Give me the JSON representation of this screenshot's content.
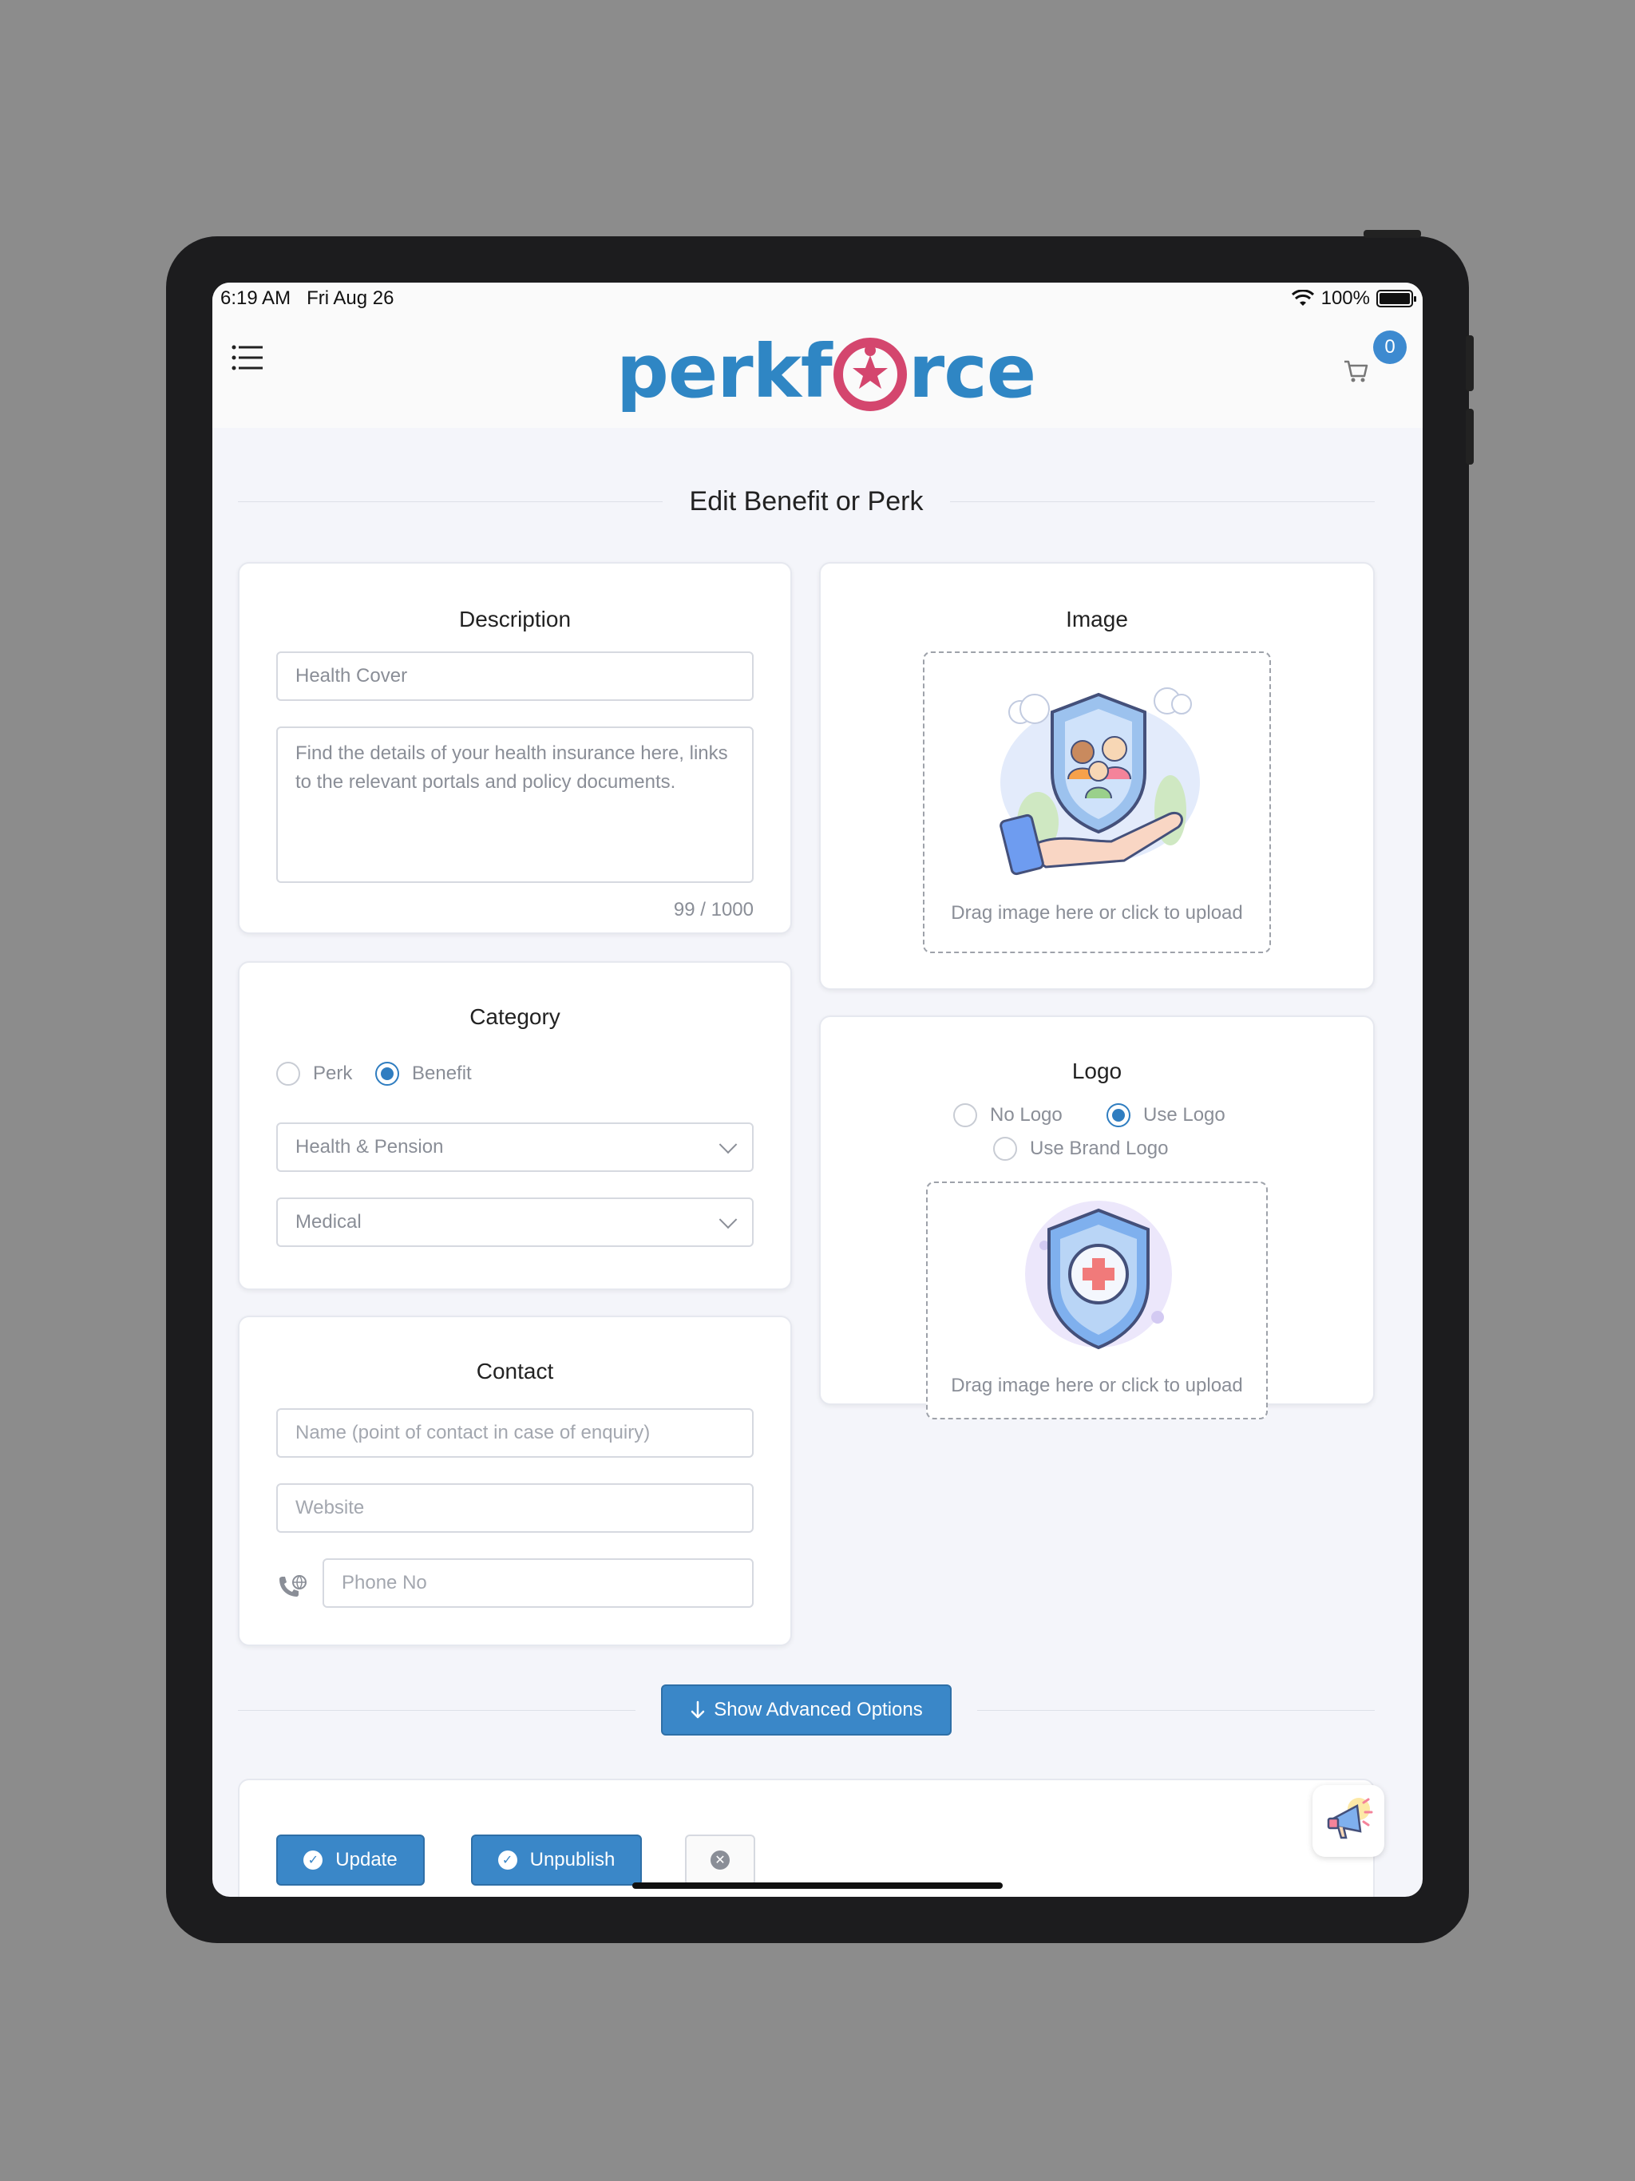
{
  "status": {
    "time": "6:19 AM",
    "date": "Fri Aug 26",
    "battery": "100%",
    "battery_level": 1.0
  },
  "header": {
    "logo_text_left": "perkf",
    "logo_text_right": "rce",
    "cart_count": "0"
  },
  "page": {
    "title": "Edit Benefit or Perk"
  },
  "description": {
    "title": "Description",
    "name_value": "Health Cover",
    "body_value": "Find the details of your health insurance here, links to the relevant portals and policy documents.",
    "counter": "99 / 1000"
  },
  "image": {
    "title": "Image",
    "dropzone_text": "Drag image here or click to upload"
  },
  "category": {
    "title": "Category",
    "options": [
      {
        "label": "Perk",
        "checked": false
      },
      {
        "label": "Benefit",
        "checked": true
      }
    ],
    "primary_value": "Health & Pension",
    "secondary_value": "Medical"
  },
  "logo": {
    "title": "Logo",
    "options": [
      {
        "label": "No Logo",
        "checked": false
      },
      {
        "label": "Use Logo",
        "checked": true
      },
      {
        "label": "Use Brand Logo",
        "checked": false
      }
    ],
    "dropzone_text": "Drag image here or click to upload"
  },
  "contact": {
    "title": "Contact",
    "name_placeholder": "Name (point of contact in case of enquiry)",
    "website_placeholder": "Website",
    "phone_placeholder": "Phone No"
  },
  "advanced": {
    "label": "Show Advanced Options"
  },
  "actions": {
    "update_label": "Update",
    "unpublish_label": "Unpublish"
  },
  "colors": {
    "brand_blue": "#2f86c4",
    "brand_pink": "#d4466e",
    "button_blue": "#3a87c8"
  }
}
